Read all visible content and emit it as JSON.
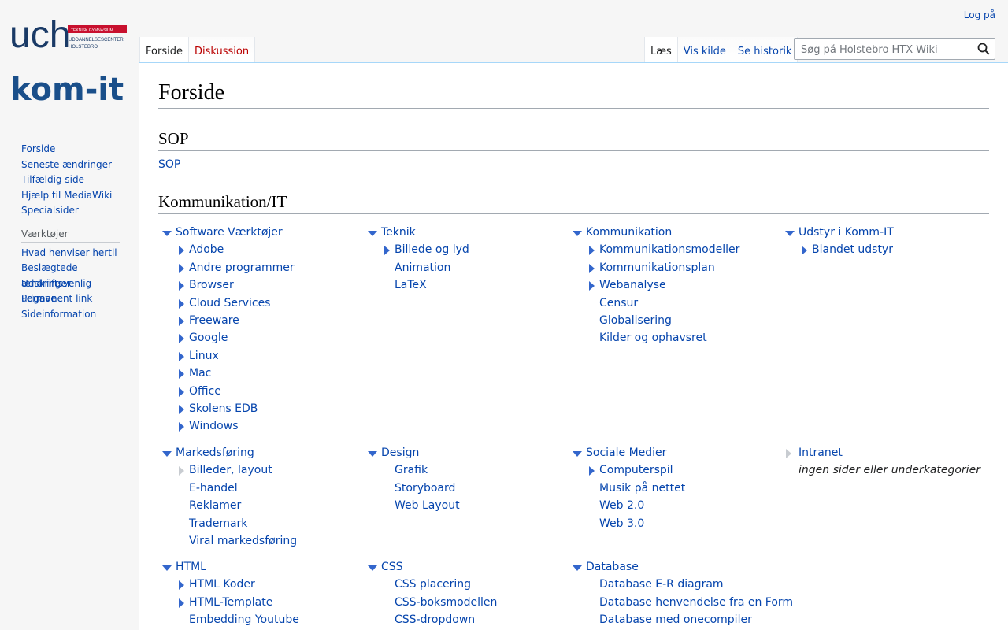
{
  "personal": {
    "login": "Log på"
  },
  "logo": {
    "brand": "uch",
    "tagline": "TEKNISK GYMNASIUM",
    "line1": "UDDANNELSESCENTER",
    "line2": "HOLSTEBRO",
    "wordmark": "kom-it"
  },
  "tabs_left": [
    "Forside",
    "Diskussion"
  ],
  "tabs_right": [
    "Læs",
    "Vis kilde",
    "Se historik"
  ],
  "search": {
    "placeholder": "Søg på Holstebro HTX Wiki"
  },
  "nav": [
    "Forside",
    "Seneste ændringer",
    "Tilfældig side",
    "Hjælp til MediaWiki",
    "Specialsider"
  ],
  "tools": {
    "heading": "Værktøjer",
    "items": [
      "Hvad henviser hertil",
      "Beslægtede ændringer",
      "Udskriftsvenlig udgave",
      "Permanent link",
      "Sideinformation"
    ]
  },
  "page": {
    "title": "Forside",
    "h_sop": "SOP",
    "sop_link": "SOP",
    "h_komm": "Kommunikation/IT"
  },
  "categories": [
    {
      "title": "Software Værktøjer",
      "children": [
        {
          "t": "Adobe",
          "b": "r"
        },
        {
          "t": "Andre programmer",
          "b": "r"
        },
        {
          "t": "Browser",
          "b": "r"
        },
        {
          "t": "Cloud Services",
          "b": "r"
        },
        {
          "t": "Freeware",
          "b": "r"
        },
        {
          "t": "Google",
          "b": "r"
        },
        {
          "t": "Linux",
          "b": "r"
        },
        {
          "t": "Mac",
          "b": "r"
        },
        {
          "t": "Office",
          "b": "r"
        },
        {
          "t": "Skolens EDB",
          "b": "r"
        },
        {
          "t": "Windows",
          "b": "r"
        }
      ]
    },
    {
      "title": "Teknik",
      "children": [
        {
          "t": "Billede og lyd",
          "b": "r"
        },
        {
          "t": "Animation",
          "b": ""
        },
        {
          "t": "LaTeX",
          "b": ""
        }
      ]
    },
    {
      "title": "Kommunikation",
      "children": [
        {
          "t": "Kommunikationsmodeller",
          "b": "r"
        },
        {
          "t": "Kommunikationsplan",
          "b": "r"
        },
        {
          "t": "Webanalyse",
          "b": "r"
        },
        {
          "t": "Censur",
          "b": ""
        },
        {
          "t": "Globalisering",
          "b": ""
        },
        {
          "t": "Kilder og ophavsret",
          "b": ""
        }
      ]
    },
    {
      "title": "Udstyr i Komm-IT",
      "children": [
        {
          "t": "Blandet udstyr",
          "b": "r"
        }
      ]
    },
    {
      "title": "Markedsføring",
      "children": [
        {
          "t": "Billeder, layout",
          "b": "e"
        },
        {
          "t": "E-handel",
          "b": ""
        },
        {
          "t": "Reklamer",
          "b": ""
        },
        {
          "t": "Trademark",
          "b": ""
        },
        {
          "t": "Viral markedsføring",
          "b": ""
        }
      ]
    },
    {
      "title": "Design",
      "children": [
        {
          "t": "Grafik",
          "b": ""
        },
        {
          "t": "Storyboard",
          "b": ""
        },
        {
          "t": "Web Layout",
          "b": ""
        }
      ]
    },
    {
      "title": "Sociale Medier",
      "children": [
        {
          "t": "Computerspil",
          "b": "r"
        },
        {
          "t": "Musik på nettet",
          "b": ""
        },
        {
          "t": "Web 2.0",
          "b": ""
        },
        {
          "t": "Web 3.0",
          "b": ""
        }
      ]
    },
    {
      "title": "Intranet",
      "collapsed": true,
      "empty_note": "ingen sider eller underkategorier",
      "children": []
    },
    {
      "title": "HTML",
      "children": [
        {
          "t": "HTML Koder",
          "b": "r"
        },
        {
          "t": "HTML-Template",
          "b": "r"
        },
        {
          "t": "Embedding Youtube",
          "b": ""
        }
      ]
    },
    {
      "title": "CSS",
      "children": [
        {
          "t": "CSS placering",
          "b": ""
        },
        {
          "t": "CSS-boksmodellen",
          "b": ""
        },
        {
          "t": "CSS-dropdown",
          "b": ""
        }
      ]
    },
    {
      "title": "Database",
      "children": [
        {
          "t": "Database E-R diagram",
          "b": ""
        },
        {
          "t": "Database henvendelse fra en Form",
          "b": ""
        },
        {
          "t": "Database med onecompiler",
          "b": ""
        }
      ]
    }
  ]
}
